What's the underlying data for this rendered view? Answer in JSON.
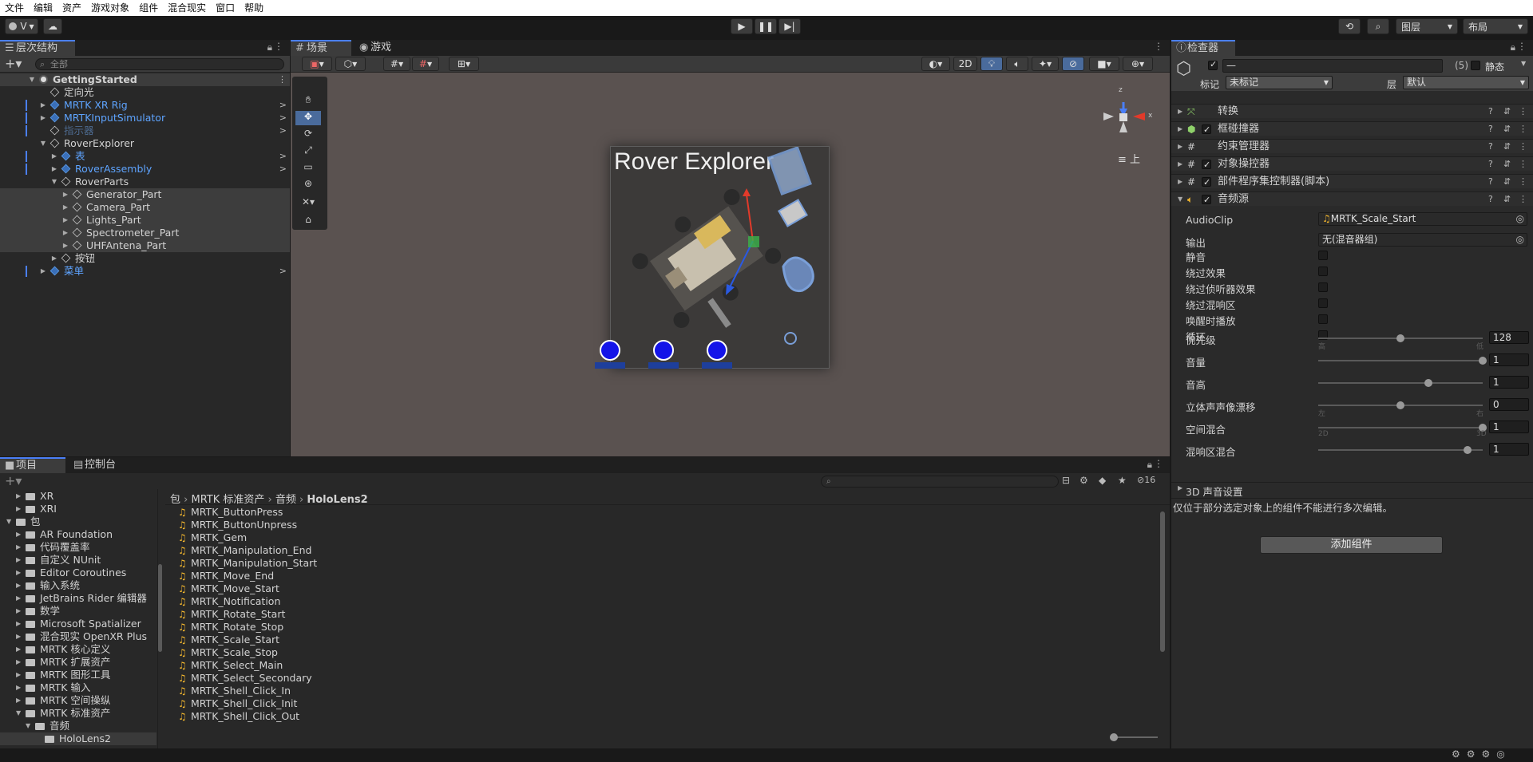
{
  "menubar": [
    "文件",
    "编辑",
    "资产",
    "游戏对象",
    "组件",
    "混合现实",
    "窗口",
    "帮助"
  ],
  "toolbar": {
    "account": "V",
    "play_icon": "play-icon",
    "pause_icon": "pause-icon",
    "step_icon": "step-icon",
    "layers": "图层",
    "layout": "布局"
  },
  "hierarchy": {
    "tab": "层次结构",
    "search_placeholder": "全部",
    "rows": [
      {
        "label": "GettingStarted",
        "style": "scene",
        "indent": 0
      },
      {
        "label": "定向光",
        "style": "normal",
        "indent": 1
      },
      {
        "label": "MRTK XR Rig",
        "style": "prefab",
        "indent": 1
      },
      {
        "label": "MRTKInputSimulator",
        "style": "prefab",
        "indent": 1
      },
      {
        "label": "指示器",
        "style": "disabled",
        "indent": 1
      },
      {
        "label": "RoverExplorer",
        "style": "normal",
        "indent": 1
      },
      {
        "label": "表",
        "style": "prefab",
        "indent": 2
      },
      {
        "label": "RoverAssembly",
        "style": "prefab",
        "indent": 2
      },
      {
        "label": "RoverParts",
        "style": "normal",
        "indent": 2
      },
      {
        "label": "Generator_Part",
        "style": "normal",
        "indent": 3
      },
      {
        "label": "Camera_Part",
        "style": "normal",
        "indent": 3
      },
      {
        "label": "Lights_Part",
        "style": "normal",
        "indent": 3
      },
      {
        "label": "Spectrometer_Part",
        "style": "normal",
        "indent": 3
      },
      {
        "label": "UHFAntena_Part",
        "style": "normal",
        "indent": 3
      },
      {
        "label": "按钮",
        "style": "normal",
        "indent": 2
      },
      {
        "label": "菜单",
        "style": "prefab",
        "indent": 1
      }
    ]
  },
  "scene": {
    "tabs": [
      "场景",
      "游戏"
    ],
    "mode_2d": "2D",
    "title": "Rover Explorer",
    "gizmo_label": "上",
    "axis_z": "z",
    "axis_x": "x"
  },
  "inspector": {
    "tab": "检查器",
    "name_value": "—",
    "count": "(5)",
    "static_label": "静态",
    "tag_label": "标记",
    "tag_value": "未标记",
    "layer_label": "层",
    "layer_value": "默认",
    "components": [
      {
        "name": "转换",
        "checkbox": false,
        "icon": "transform-icon"
      },
      {
        "name": "框碰撞器",
        "checkbox": true,
        "icon": "box-collider-icon"
      },
      {
        "name": "约束管理器",
        "checkbox": false,
        "icon": "script-icon"
      },
      {
        "name": "对象操控器",
        "checkbox": true,
        "icon": "script-icon"
      },
      {
        "name": "部件程序集控制器(脚本)",
        "checkbox": true,
        "icon": "script-icon"
      },
      {
        "name": "音频源",
        "checkbox": true,
        "icon": "audio-icon"
      }
    ],
    "audio": {
      "clip_label": "AudioClip",
      "clip_value": "MRTK_Scale_Start",
      "output_label": "输出",
      "output_value": "无(混音器组)",
      "toggles": [
        "静音",
        "绕过效果",
        "绕过侦听器效果",
        "绕过混响区",
        "唤醒时播放",
        "循环"
      ],
      "sliders": [
        {
          "label": "优先级",
          "value": "128",
          "fraction": 0.5,
          "left": "高",
          "right": "低"
        },
        {
          "label": "音量",
          "value": "1",
          "fraction": 1.0,
          "left": "",
          "right": ""
        },
        {
          "label": "音高",
          "value": "1",
          "fraction": 0.67,
          "left": "",
          "right": ""
        },
        {
          "label": "立体声声像漂移",
          "value": "0",
          "fraction": 0.5,
          "left": "左",
          "right": "右"
        },
        {
          "label": "空间混合",
          "value": "1",
          "fraction": 1.0,
          "left": "2D",
          "right": "3D"
        },
        {
          "label": "混响区混合",
          "value": "1",
          "fraction": 0.91,
          "left": "",
          "right": ""
        }
      ],
      "sound_3d": "3D 声音设置"
    },
    "multi_edit_note": "仅位于部分选定对象上的组件不能进行多次编辑。",
    "add_component": "添加组件"
  },
  "project": {
    "tabs": [
      "项目",
      "控制台"
    ],
    "hidden_count": "16",
    "breadcrumb": [
      "包",
      "MRTK 标准资产",
      "音频",
      "HoloLens2"
    ],
    "tree": [
      {
        "label": "XR",
        "indent": 1
      },
      {
        "label": "XRI",
        "indent": 1
      },
      {
        "label": "包",
        "indent": 0
      },
      {
        "label": "AR Foundation",
        "indent": 1
      },
      {
        "label": "代码覆盖率",
        "indent": 1
      },
      {
        "label": "自定义 NUnit",
        "indent": 1
      },
      {
        "label": "Editor Coroutines",
        "indent": 1
      },
      {
        "label": "输入系统",
        "indent": 1
      },
      {
        "label": "JetBrains Rider 编辑器",
        "indent": 1
      },
      {
        "label": "数学",
        "indent": 1
      },
      {
        "label": "Microsoft Spatializer",
        "indent": 1
      },
      {
        "label": "混合现实 OpenXR Plus",
        "indent": 1
      },
      {
        "label": "MRTK 核心定义",
        "indent": 1
      },
      {
        "label": "MRTK 扩展资产",
        "indent": 1
      },
      {
        "label": "MRTK 图形工具",
        "indent": 1
      },
      {
        "label": "MRTK 输入",
        "indent": 1
      },
      {
        "label": "MRTK 空间操纵",
        "indent": 1
      },
      {
        "label": "MRTK 标准资产",
        "indent": 1
      },
      {
        "label": "音频",
        "indent": 2
      },
      {
        "label": "HoloLens2",
        "indent": 3
      }
    ],
    "files": [
      "MRTK_ButtonPress",
      "MRTK_ButtonUnpress",
      "MRTK_Gem",
      "MRTK_Manipulation_End",
      "MRTK_Manipulation_Start",
      "MRTK_Move_End",
      "MRTK_Move_Start",
      "MRTK_Notification",
      "MRTK_Rotate_Start",
      "MRTK_Rotate_Stop",
      "MRTK_Scale_Start",
      "MRTK_Scale_Stop",
      "MRTK_Select_Main",
      "MRTK_Select_Secondary",
      "MRTK_Shell_Click_In",
      "MRTK_Shell_Click_Init",
      "MRTK_Shell_Click_Out"
    ]
  },
  "colors": {
    "accent": "#4a7ff7",
    "prefab": "#5ea4ff",
    "scene_bg": "#5a5250"
  }
}
